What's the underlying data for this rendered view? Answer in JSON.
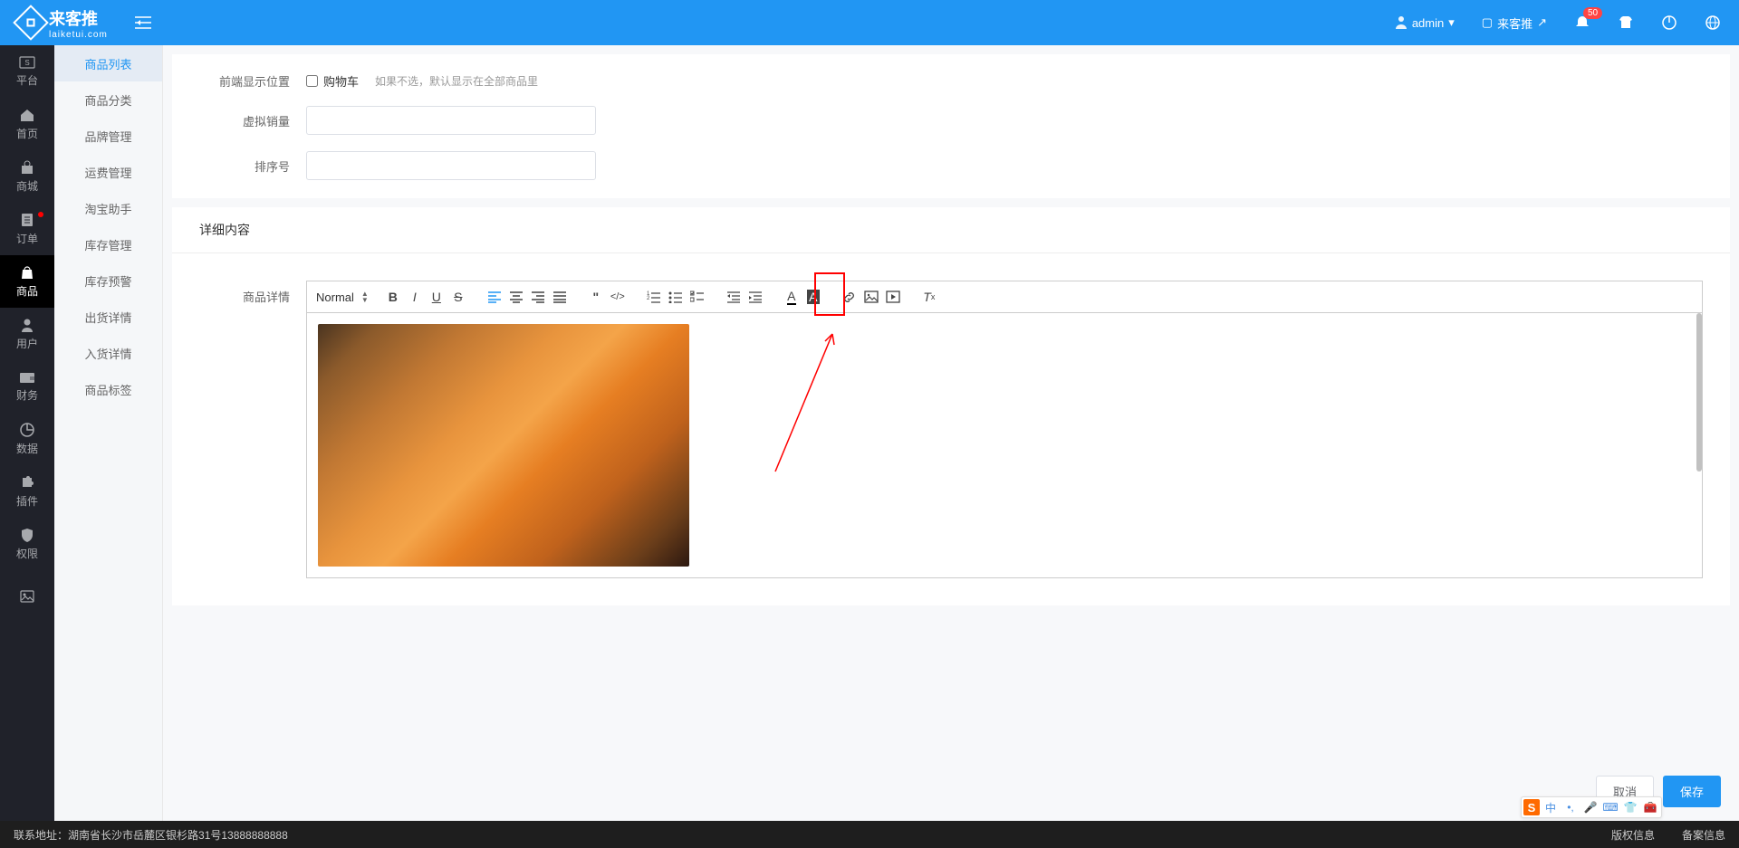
{
  "header": {
    "brand_main": "来客推",
    "brand_sub": "laiketui.com",
    "admin_label": "admin",
    "hub_label": "来客推",
    "notification_count": "50"
  },
  "nav_primary": [
    {
      "label": "平台",
      "icon": "card"
    },
    {
      "label": "首页",
      "icon": "home"
    },
    {
      "label": "商城",
      "icon": "store"
    },
    {
      "label": "订单",
      "icon": "list",
      "dot": true
    },
    {
      "label": "商品",
      "icon": "bag",
      "active": true
    },
    {
      "label": "用户",
      "icon": "user"
    },
    {
      "label": "财务",
      "icon": "wallet"
    },
    {
      "label": "数据",
      "icon": "chart"
    },
    {
      "label": "插件",
      "icon": "puzzle"
    },
    {
      "label": "权限",
      "icon": "shield"
    },
    {
      "label": "",
      "icon": "image"
    }
  ],
  "nav_secondary": [
    {
      "label": "商品列表",
      "active": true
    },
    {
      "label": "商品分类"
    },
    {
      "label": "品牌管理"
    },
    {
      "label": "运费管理"
    },
    {
      "label": "淘宝助手"
    },
    {
      "label": "库存管理"
    },
    {
      "label": "库存预警"
    },
    {
      "label": "出货详情"
    },
    {
      "label": "入货详情"
    },
    {
      "label": "商品标签"
    }
  ],
  "form": {
    "display_position_label": "前端显示位置",
    "cart_label": "购物车",
    "display_hint": "如果不选，默认显示在全部商品里",
    "virtual_sales_label": "虚拟销量",
    "sort_label": "排序号"
  },
  "detail_section_title": "详细内容",
  "editor": {
    "label": "商品详情",
    "format_option": "Normal"
  },
  "actions": {
    "cancel": "取消",
    "save": "保存"
  },
  "footer": {
    "address_label": "联系地址：",
    "address_value": "湖南省长沙市岳麓区银杉路31号13888888888",
    "copyright": "版权信息",
    "filing": "备案信息"
  },
  "ime": {
    "lang": "中"
  }
}
